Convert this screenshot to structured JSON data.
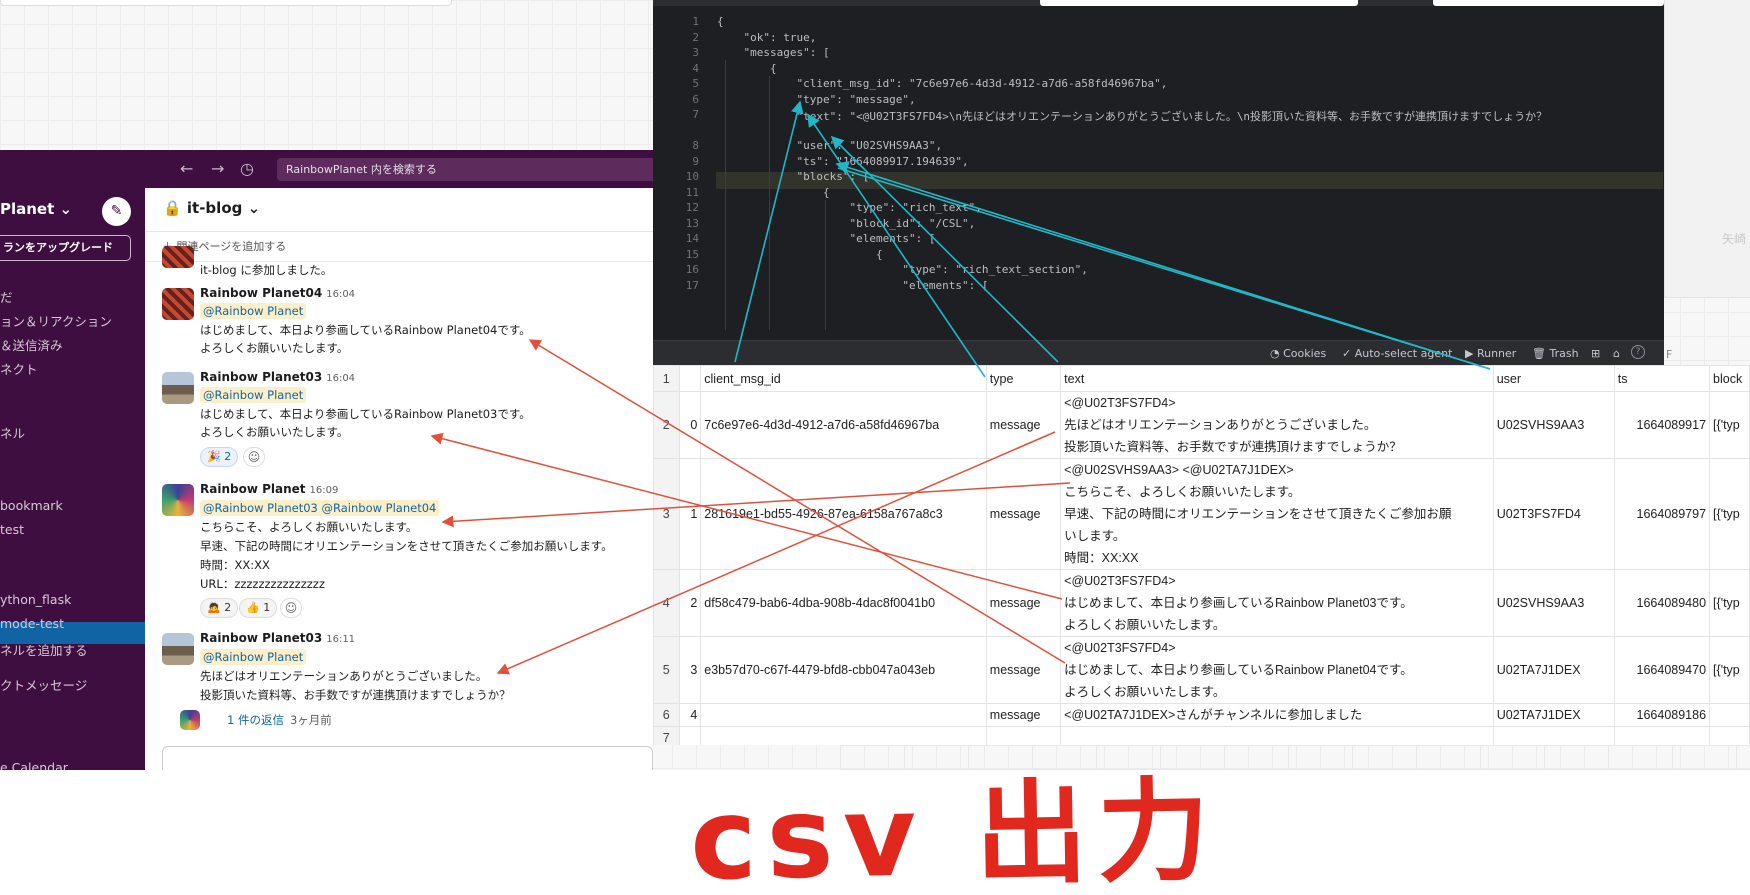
{
  "slack": {
    "search_placeholder": "RainbowPlanet 内を検索する",
    "workspace_name": "Planet ⌄",
    "upgrade_label": "ランをアップグレード",
    "channel_title": "🔒 it-blog ⌄",
    "add_bookmark": "＋ 関連ページを追加する",
    "sidebar_items": [
      "だ",
      "ョン＆リアクション",
      "＆送信済み",
      "ネクト",
      "ネル",
      "bookmark",
      "test",
      "ython_flask",
      "mode-test",
      "ネルを追加する",
      "クトメッセージ",
      "e Calendar"
    ],
    "join_notice": "it-blog に参加しました。",
    "messages": [
      {
        "name": "Rainbow Planet04",
        "time": "16:04",
        "mentions": "@Rainbow Planet",
        "lines": [
          "はじめまして、本日より参画しているRainbow Planet04です。",
          "よろしくお願いいたします。"
        ]
      },
      {
        "name": "Rainbow Planet03",
        "time": "16:04",
        "mentions": "@Rainbow Planet",
        "lines": [
          "はじめまして、本日より参画しているRainbow Planet03です。",
          "よろしくお願いいたします。"
        ],
        "reactions": [
          "🎉 2"
        ]
      },
      {
        "name": "Rainbow Planet",
        "time": "16:09",
        "mentions": "@Rainbow Planet03  @Rainbow Planet04",
        "lines": [
          "こちらこそ、よろしくお願いいたします。",
          "早速、下記の時間にオリエンテーションをさせて頂きたくご参加お願いします。",
          "時間：XX:XX",
          "URL：zzzzzzzzzzzzzzz"
        ],
        "reactions": [
          "🙇 2",
          "👍 1"
        ]
      },
      {
        "name": "Rainbow Planet03",
        "time": "16:11",
        "mentions": "@Rainbow Planet",
        "lines": [
          "先ほどはオリエンテーションありがとうございました。",
          "投影頂いた資料等、お手数ですが連携頂けますでしょうか？"
        ],
        "thread": "1 件の返信",
        "thread_ago": "3ヶ月前"
      }
    ]
  },
  "editor": {
    "line_numbers": [
      "1",
      "2",
      "3",
      "4",
      "5",
      "6",
      "7",
      "8",
      "9",
      "10",
      "11",
      "12",
      "13",
      "14",
      "15",
      "16",
      "17"
    ],
    "lines": [
      "{",
      "    \"ok\": true,",
      "    \"messages\": [",
      "        {",
      "            \"client_msg_id\": \"7c6e97e6-4d3d-4912-a7d6-a58fd46967ba\",",
      "            \"type\": \"message\",",
      "            \"text\": \"<@U02T3FS7FD4>\\n先ほどはオリエンテーションありがとうございました。\\n投影頂いた資料等、お手数ですが連携頂けますでしょうか？",
      "            \"user\": \"U02SVHS9AA3\",",
      "            \"ts\": \"1664089917.194639\",",
      "            \"blocks\": [",
      "                {",
      "                    \"type\": \"rich_text\",",
      "                    \"block_id\": \"/CSL\",",
      "                    \"elements\": [",
      "                        {",
      "                            \"type\": \"rich_text_section\",",
      "                            \"elements\": ["
    ],
    "status": {
      "cookies": "Cookies",
      "auto_select": "Auto-select agent",
      "runner": "Runner",
      "trash": "Trash"
    }
  },
  "table": {
    "header": [
      "client_msg_id",
      "type",
      "text",
      "user",
      "ts",
      "block"
    ],
    "rows": [
      {
        "rn": "2",
        "idx": "0",
        "id": "7c6e97e6-4d3d-4912-a7d6-a58fd46967ba",
        "type": "message",
        "text": [
          "<@U02T3FS7FD4>",
          "先ほどはオリエンテーションありがとうございました。",
          "投影頂いた資料等、お手数ですが連携頂けますでしょうか？"
        ],
        "user": "U02SVHS9AA3",
        "ts": "1664089917",
        "block": "[{'typ"
      },
      {
        "rn": "3",
        "idx": "1",
        "id": "281619e1-bd55-4926-87ea-6158a767a8c3",
        "type": "message",
        "text": [
          "<@U02SVHS9AA3> <@U02TA7J1DEX>",
          "こちらこそ、よろしくお願いいたします。",
          "早速、下記の時間にオリエンテーションをさせて頂きたくご参加お願",
          "いします。",
          "時間：XX:XX"
        ],
        "user": "U02T3FS7FD4",
        "ts": "1664089797",
        "block": "[{'typ"
      },
      {
        "rn": "4",
        "idx": "2",
        "id": "df58c479-bab6-4dba-908b-4dac8f0041b0",
        "type": "message",
        "text": [
          "<@U02T3FS7FD4>",
          "はじめまして、本日より参画しているRainbow Planet03です。",
          "よろしくお願いいたします。"
        ],
        "user": "U02SVHS9AA3",
        "ts": "1664089480",
        "block": "[{'typ"
      },
      {
        "rn": "5",
        "idx": "3",
        "id": "e3b57d70-c67f-4479-bfd8-cbb047a043eb",
        "type": "message",
        "text": [
          "<@U02T3FS7FD4>",
          "はじめまして、本日より参画しているRainbow Planet04です。",
          "よろしくお願いいたします。"
        ],
        "user": "U02TA7J1DEX",
        "ts": "1664089470",
        "block": "[{'typ"
      },
      {
        "rn": "6",
        "idx": "4",
        "id": "",
        "type": "message",
        "text": [
          "<@U02TA7J1DEX>さんがチャンネルに参加しました"
        ],
        "user": "U02TA7J1DEX",
        "ts": "1664089186",
        "block": ""
      },
      {
        "rn": "7",
        "idx": "",
        "id": "",
        "type": "",
        "text": [
          ""
        ],
        "user": "",
        "ts": "",
        "block": ""
      }
    ],
    "col_f": "F"
  },
  "annotation": "csv 出力",
  "right_note": "矢崎",
  "colors": {
    "slack_purple": "#3f0e40",
    "cyan_arrow": "#1fb8c9",
    "red_arrow": "#e0503a",
    "handwriting_red": "#e0281f"
  }
}
